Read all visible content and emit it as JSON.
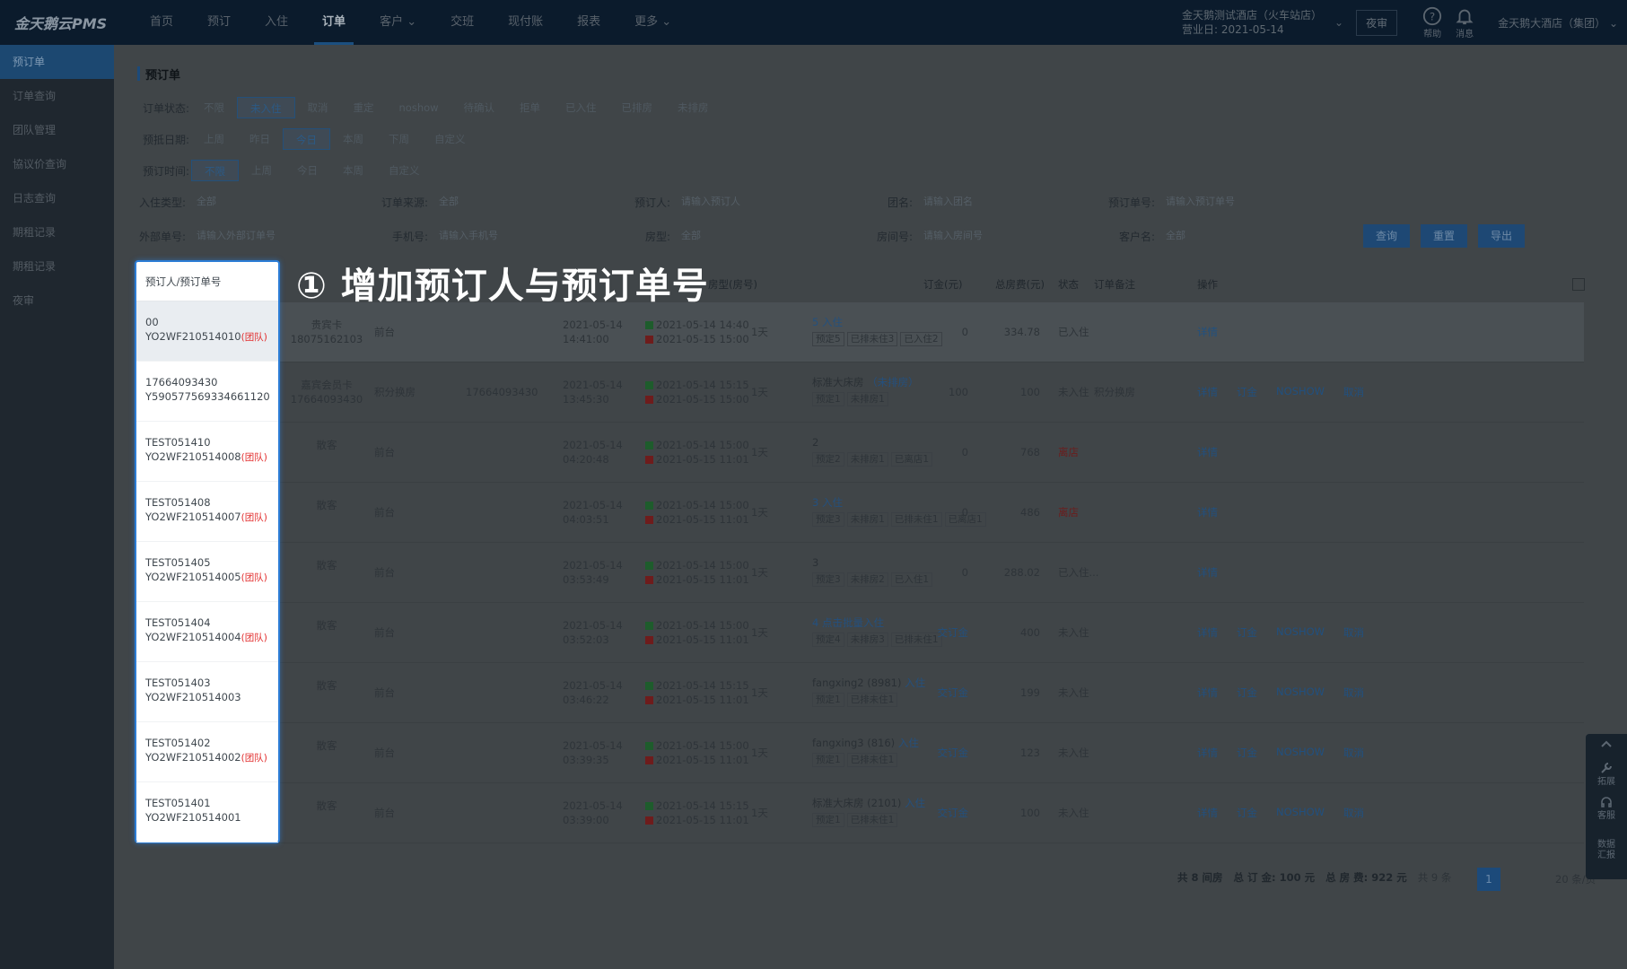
{
  "app": {
    "logo": "金天鹅云PMS"
  },
  "nav": [
    "首页",
    "预订",
    "入住",
    "订单",
    "客户 ⌄",
    "交班",
    "现付账",
    "报表",
    "更多 ⌄"
  ],
  "hotel": {
    "name": "金天鹅测试酒店（火车站店）",
    "business_day": "营业日: 2021-05-14"
  },
  "night_audit": "夜审",
  "help_label": "帮助",
  "msg_label": "消息",
  "group_name": "金天鹅大酒店（集团） ⌄",
  "sidebar": [
    "预订单",
    "订单查询",
    "团队管理",
    "協议价查询",
    "日志查询",
    "期租记录",
    "期租记录",
    "夜审"
  ],
  "page_title": "预订单",
  "filters": {
    "order_status": {
      "label": "订单状态:",
      "options": [
        "不限",
        "未入住",
        "取消",
        "重定",
        "noshow",
        "待确认",
        "拒单",
        "已入住",
        "已排房",
        "未排房"
      ]
    },
    "arrival_date": {
      "label": "预抵日期:",
      "options": [
        "上周",
        "昨日",
        "今日",
        "本周",
        "下周",
        "自定义"
      ]
    },
    "booking_time": {
      "label": "预订时间:",
      "options": [
        "不限",
        "上周",
        "今日",
        "本周",
        "自定义"
      ]
    }
  },
  "fields": {
    "checkin_type": {
      "label": "入住类型:",
      "value": "全部"
    },
    "order_source": {
      "label": "订单来源:",
      "value": "全部"
    },
    "booker": {
      "label": "预订人:",
      "value": "请输入预订人"
    },
    "group": {
      "label": "团名:",
      "value": "请输入团名"
    },
    "booking_no": {
      "label": "预订单号:",
      "value": "请输入预订单号"
    },
    "external_no": {
      "label": "外部单号:",
      "value": "请输入外部订单号"
    },
    "phone": {
      "label": "手机号:",
      "value": "请输入手机号"
    },
    "room_type": {
      "label": "房型:",
      "value": "全部"
    },
    "room_no": {
      "label": "房间号:",
      "value": "请输入房间号"
    },
    "customer": {
      "label": "客户名:",
      "value": "全部"
    }
  },
  "buttons": {
    "query": "查询",
    "reset": "重置",
    "print": "导出"
  },
  "table_headers": {
    "booker": "预订人/预订单号",
    "room": "房型(房号)",
    "deposit": "订金(元)",
    "total": "总房费(元)",
    "status": "状态",
    "remark": "订单备注",
    "ops": "操作"
  },
  "rows": [
    {
      "booker": "00",
      "no": "YO2WF210514010",
      "group": true,
      "guest": "贵宾卡",
      "phone": "18075162103",
      "source": "前台",
      "ext": "",
      "book_date": "2021-05-14",
      "book_time": "14:41:00",
      "arrive": "2021-05-14 14:40",
      "leave": "2021-05-15 15:00",
      "nights": "1天",
      "room_top": "5 入住",
      "room_dark": "",
      "tags": [
        "预定5",
        "已排未住3",
        "已入住2"
      ],
      "deposit": "0",
      "total": "334.78",
      "status": "已入住",
      "remark": "",
      "ops": [
        "详情"
      ]
    },
    {
      "booker": "17664093430",
      "no": "Y590577569334661120",
      "group": false,
      "guest": "嘉宾会员卡",
      "phone": "17664093430",
      "source": "积分换房",
      "ext": "17664093430",
      "book_date": "2021-05-14",
      "book_time": "13:45:30",
      "arrive": "2021-05-14 15:15",
      "leave": "2021-05-15 15:00",
      "nights": "1天",
      "room_top": "（未排房）",
      "room_dark": "标准大床房 ",
      "tags": [
        "预定1",
        "未排房1"
      ],
      "deposit": "100",
      "total": "100",
      "status": "未入住",
      "remark": "积分换房",
      "ops": [
        "详情",
        "订金",
        "NOSHOW",
        "取消"
      ]
    },
    {
      "booker": "TEST051410",
      "no": "YO2WF210514008",
      "group": true,
      "guest": "散客",
      "phone": "",
      "source": "前台",
      "ext": "",
      "book_date": "2021-05-14",
      "book_time": "04:20:48",
      "arrive": "2021-05-14 15:00",
      "leave": "2021-05-15 11:01",
      "nights": "1天",
      "room_top": "",
      "room_dark": "2",
      "tags": [
        "预定2",
        "未排房1",
        "已离店1"
      ],
      "deposit": "0",
      "total": "768",
      "status": "离店",
      "remark": "",
      "ops": [
        "详情"
      ]
    },
    {
      "booker": "TEST051408",
      "no": "YO2WF210514007",
      "group": true,
      "guest": "散客",
      "phone": "",
      "source": "前台",
      "ext": "",
      "book_date": "2021-05-14",
      "book_time": "04:03:51",
      "arrive": "2021-05-14 15:00",
      "leave": "2021-05-15 11:01",
      "nights": "1天",
      "room_top": "3 入住",
      "room_dark": "",
      "tags": [
        "预定3",
        "未排房1",
        "已排未住1",
        "已离店1"
      ],
      "deposit": "0",
      "total": "486",
      "status": "离店",
      "remark": "",
      "ops": [
        "详情"
      ]
    },
    {
      "booker": "TEST051405",
      "no": "YO2WF210514005",
      "group": true,
      "guest": "散客",
      "phone": "",
      "source": "前台",
      "ext": "",
      "book_date": "2021-05-14",
      "book_time": "03:53:49",
      "arrive": "2021-05-14 15:00",
      "leave": "2021-05-15 11:01",
      "nights": "1天",
      "room_top": "",
      "room_dark": "3",
      "tags": [
        "预定3",
        "未排房2",
        "已入住1"
      ],
      "deposit": "0",
      "total": "288.02",
      "status": "已入住...",
      "remark": "",
      "ops": [
        "详情"
      ]
    },
    {
      "booker": "TEST051404",
      "no": "YO2WF210514004",
      "group": true,
      "guest": "散客",
      "phone": "",
      "source": "前台",
      "ext": "",
      "book_date": "2021-05-14",
      "book_time": "03:52:03",
      "arrive": "2021-05-14 15:00",
      "leave": "2021-05-15 11:01",
      "nights": "1天",
      "room_top": "4 点击批量入住",
      "room_dark": "",
      "tags": [
        "预定4",
        "未排房3",
        "已排未住1"
      ],
      "deposit": "交订金",
      "total": "400",
      "status": "未入住",
      "remark": "",
      "ops": [
        "详情",
        "订金",
        "NOSHOW",
        "取消"
      ]
    },
    {
      "booker": "TEST051403",
      "no": "YO2WF210514003",
      "group": false,
      "guest": "散客",
      "phone": "",
      "source": "前台",
      "ext": "",
      "book_date": "2021-05-14",
      "book_time": "03:46:22",
      "arrive": "2021-05-14 15:15",
      "leave": "2021-05-15 11:01",
      "nights": "1天",
      "room_top": "入住",
      "room_dark": "fangxing2 (8981) ",
      "tags": [
        "预定1",
        "已排未住1"
      ],
      "deposit": "交订金",
      "total": "199",
      "status": "未入住",
      "remark": "",
      "ops": [
        "详情",
        "订金",
        "NOSHOW",
        "取消"
      ]
    },
    {
      "booker": "TEST051402",
      "no": "YO2WF210514002",
      "group": true,
      "guest": "散客",
      "phone": "",
      "source": "前台",
      "ext": "",
      "book_date": "2021-05-14",
      "book_time": "03:39:35",
      "arrive": "2021-05-14 15:00",
      "leave": "2021-05-15 11:01",
      "nights": "1天",
      "room_top": "入住",
      "room_dark": "fangxing3 (816) ",
      "tags": [
        "预定1",
        "已排未住1"
      ],
      "deposit": "交订金",
      "total": "123",
      "status": "未入住",
      "remark": "",
      "ops": [
        "详情",
        "订金",
        "NOSHOW",
        "取消"
      ]
    },
    {
      "booker": "TEST051401",
      "no": "YO2WF210514001",
      "group": false,
      "guest": "散客",
      "phone": "",
      "source": "前台",
      "ext": "",
      "book_date": "2021-05-14",
      "book_time": "03:39:00",
      "arrive": "2021-05-14 15:15",
      "leave": "2021-05-15 11:01",
      "nights": "1天",
      "room_top": "入住",
      "room_dark": "标准大床房 (2101) ",
      "tags": [
        "预定1",
        "已排未住1"
      ],
      "deposit": "交订金",
      "total": "100",
      "status": "未入住",
      "remark": "",
      "ops": [
        "详情",
        "订金",
        "NOSHOW",
        "取消"
      ]
    }
  ],
  "group_tag": "(团队)",
  "annotation": "① 增加预订人与预订单号",
  "footer": {
    "count": "共 8 间房",
    "deposit_total": "总 订 金: 100 元",
    "room_total": "总 房 费: 922 元",
    "records": "共 9 条",
    "page": "1",
    "per_page": "20 条/页"
  },
  "float_tools": [
    "拓展",
    "客服",
    "数据\n汇报"
  ]
}
